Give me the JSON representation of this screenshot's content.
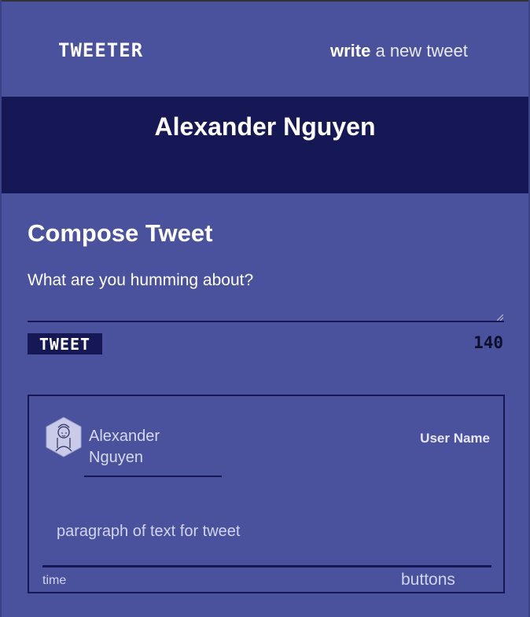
{
  "nav": {
    "brand": "TWEETER",
    "write_bold": "write",
    "write_rest": " a new tweet"
  },
  "header": {
    "name": "Alexander Nguyen"
  },
  "compose": {
    "title": "Compose Tweet",
    "placeholder": "What are you humming about?",
    "button_label": "TWEET",
    "counter": "140"
  },
  "tweet": {
    "avatar_icon": "person-avatar-icon",
    "author_name": "Alexander Nguyen",
    "handle": "User Name",
    "body": "paragraph of text for tweet",
    "time": "time",
    "buttons": "buttons"
  },
  "colors": {
    "background": "#4a529e",
    "header_band": "#161855",
    "counter": "#0d0f2b",
    "card_text": "#d2d4ec"
  }
}
